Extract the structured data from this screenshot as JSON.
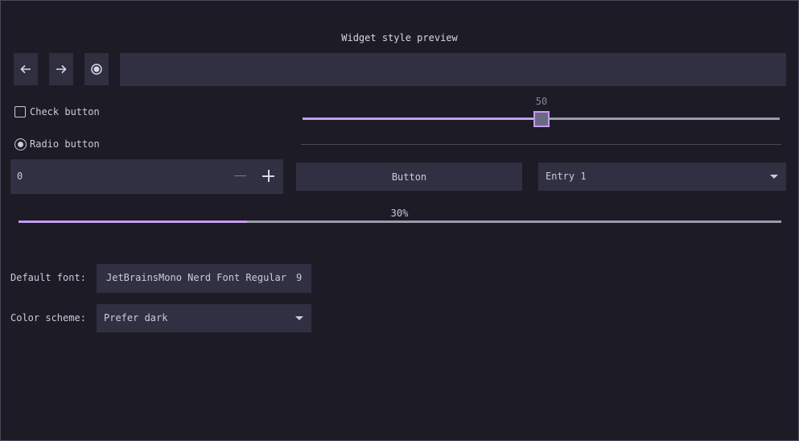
{
  "title": "Widget style preview",
  "toolbar": {
    "back_icon": "arrow-left-icon",
    "forward_icon": "arrow-right-icon",
    "record_icon": "record-icon",
    "url_value": ""
  },
  "check_button": {
    "label": "Check button",
    "checked": false
  },
  "radio_button": {
    "label": "Radio button",
    "selected": true
  },
  "slider": {
    "value": "50",
    "fraction": 0.5
  },
  "spin_button": {
    "value": "0"
  },
  "button": {
    "label": "Button"
  },
  "combo": {
    "selected": "Entry 1"
  },
  "progress": {
    "label": "30%",
    "fraction": 0.3
  },
  "settings": {
    "font_label": "Default font:",
    "font_name": "JetBrainsMono Nerd Font Regular",
    "font_size": "9",
    "scheme_label": "Color scheme:",
    "scheme_value": "Prefer dark"
  },
  "colors": {
    "background": "#1c1b26",
    "widget": "#303042",
    "accent": "#c49cf0",
    "text": "#c9ccd9"
  }
}
